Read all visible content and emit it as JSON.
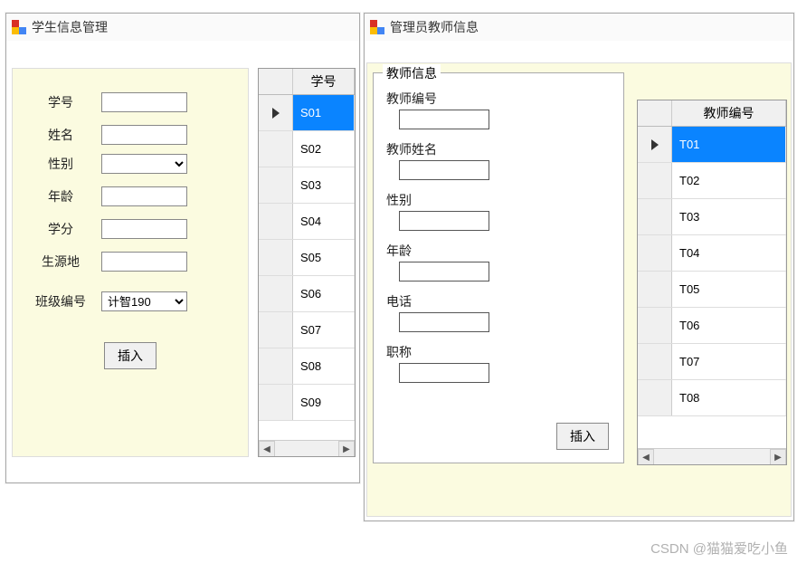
{
  "window1": {
    "title": "学生信息管理",
    "form": {
      "student_id_label": "学号",
      "name_label": "姓名",
      "gender_label": "性别",
      "age_label": "年龄",
      "credits_label": "学分",
      "origin_label": "生源地",
      "class_id_label": "班级编号",
      "class_id_value": "计智190",
      "insert_btn": "插入"
    },
    "grid": {
      "header": "学号",
      "rows": [
        "S01",
        "S02",
        "S03",
        "S04",
        "S05",
        "S06",
        "S07",
        "S08",
        "S09"
      ],
      "selected_index": 0
    }
  },
  "window2": {
    "title": "管理员教师信息",
    "groupbox": {
      "legend": "教师信息",
      "teacher_id_label": "教师编号",
      "teacher_name_label": "教师姓名",
      "gender_label": "性别",
      "age_label": "年龄",
      "phone_label": "电话",
      "title_label": "职称",
      "insert_btn": "插入"
    },
    "grid": {
      "header": "教师编号",
      "rows": [
        "T01",
        "T02",
        "T03",
        "T04",
        "T05",
        "T06",
        "T07",
        "T08"
      ],
      "selected_index": 0
    }
  },
  "watermark": "CSDN @猫猫爱吃小鱼"
}
